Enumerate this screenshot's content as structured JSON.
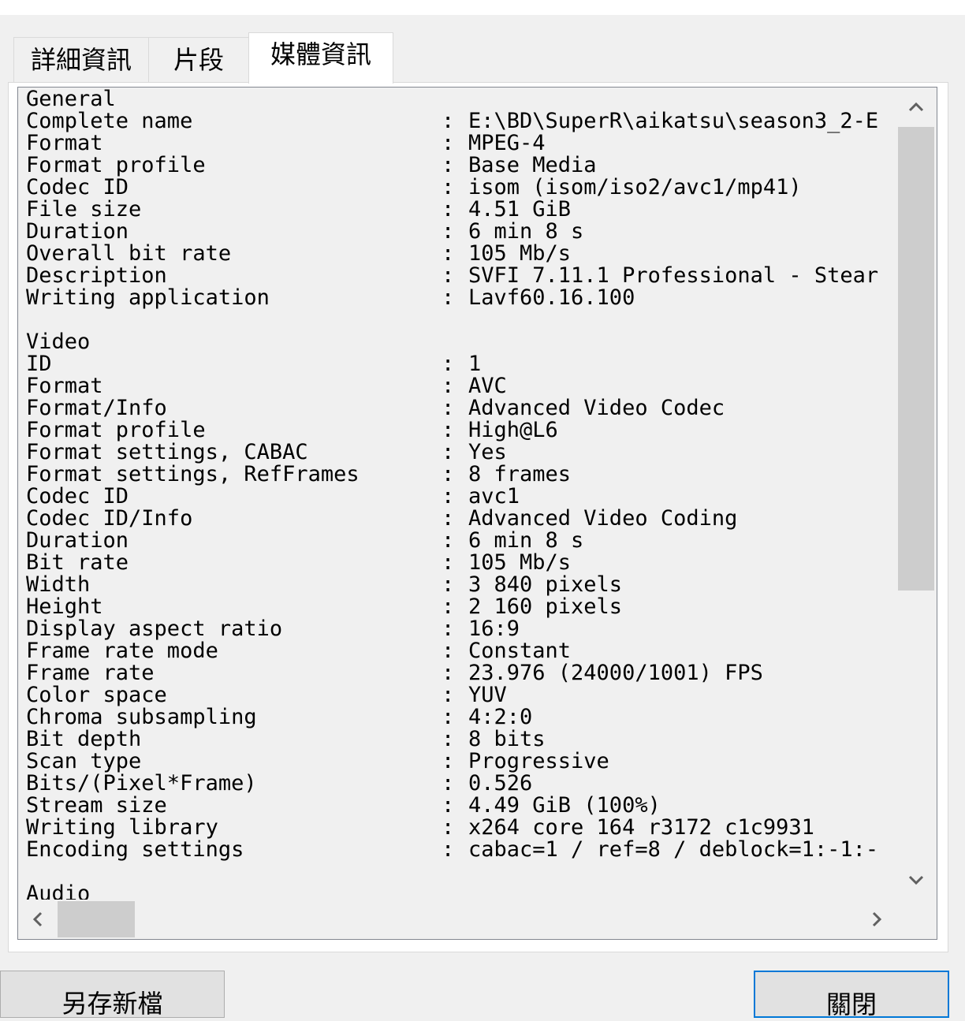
{
  "tabs": [
    {
      "label": "詳細資訊"
    },
    {
      "label": "片段"
    },
    {
      "label": "媒體資訊"
    }
  ],
  "media_info": {
    "lines": [
      {
        "k": "General",
        "v": ""
      },
      {
        "k": "Complete name",
        "v": "E:\\BD\\SuperR\\aikatsu\\season3_2-E"
      },
      {
        "k": "Format",
        "v": "MPEG-4"
      },
      {
        "k": "Format profile",
        "v": "Base Media"
      },
      {
        "k": "Codec ID",
        "v": "isom (isom/iso2/avc1/mp41)"
      },
      {
        "k": "File size",
        "v": "4.51 GiB"
      },
      {
        "k": "Duration",
        "v": "6 min 8 s"
      },
      {
        "k": "Overall bit rate",
        "v": "105 Mb/s"
      },
      {
        "k": "Description",
        "v": "SVFI 7.11.1 Professional - Stear"
      },
      {
        "k": "Writing application",
        "v": "Lavf60.16.100"
      },
      {
        "k": "",
        "v": ""
      },
      {
        "k": "Video",
        "v": ""
      },
      {
        "k": "ID",
        "v": "1"
      },
      {
        "k": "Format",
        "v": "AVC"
      },
      {
        "k": "Format/Info",
        "v": "Advanced Video Codec"
      },
      {
        "k": "Format profile",
        "v": "High@L6"
      },
      {
        "k": "Format settings, CABAC",
        "v": "Yes"
      },
      {
        "k": "Format settings, RefFrames",
        "v": "8 frames"
      },
      {
        "k": "Codec ID",
        "v": "avc1"
      },
      {
        "k": "Codec ID/Info",
        "v": "Advanced Video Coding"
      },
      {
        "k": "Duration",
        "v": "6 min 8 s"
      },
      {
        "k": "Bit rate",
        "v": "105 Mb/s"
      },
      {
        "k": "Width",
        "v": "3 840 pixels"
      },
      {
        "k": "Height",
        "v": "2 160 pixels"
      },
      {
        "k": "Display aspect ratio",
        "v": "16:9"
      },
      {
        "k": "Frame rate mode",
        "v": "Constant"
      },
      {
        "k": "Frame rate",
        "v": "23.976 (24000/1001) FPS"
      },
      {
        "k": "Color space",
        "v": "YUV"
      },
      {
        "k": "Chroma subsampling",
        "v": "4:2:0"
      },
      {
        "k": "Bit depth",
        "v": "8 bits"
      },
      {
        "k": "Scan type",
        "v": "Progressive"
      },
      {
        "k": "Bits/(Pixel*Frame)",
        "v": "0.526"
      },
      {
        "k": "Stream size",
        "v": "4.49 GiB (100%)"
      },
      {
        "k": "Writing library",
        "v": "x264 core 164 r3172 c1c9931"
      },
      {
        "k": "Encoding settings",
        "v": "cabac=1 / ref=8 / deblock=1:-1:-"
      },
      {
        "k": "",
        "v": ""
      },
      {
        "k": "Audio",
        "v": ""
      }
    ]
  },
  "buttons": {
    "save_new": "另存新檔",
    "close": "關閉"
  },
  "icons": {
    "up": "chevron-up-icon",
    "down": "chevron-down-icon",
    "left": "chevron-left-icon",
    "right": "chevron-right-icon"
  }
}
